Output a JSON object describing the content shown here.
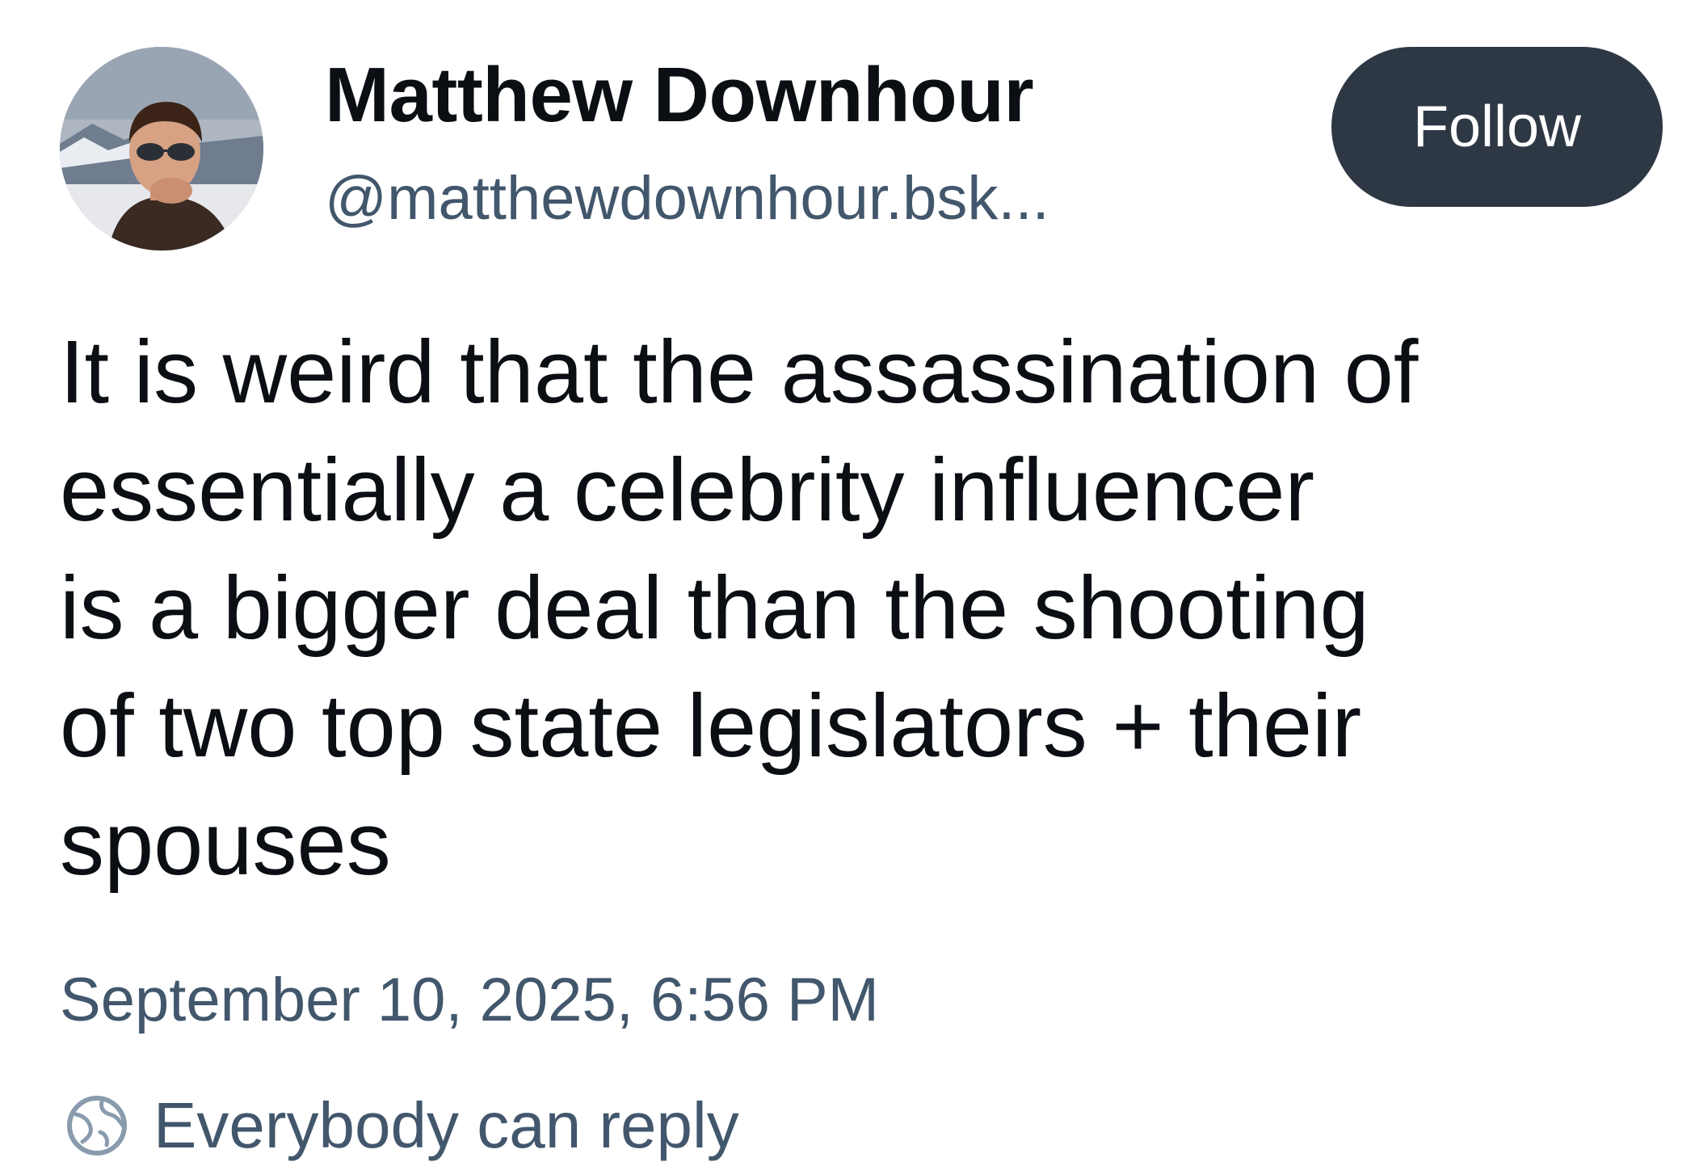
{
  "author": {
    "display_name": "Matthew Downhour",
    "handle": "@matthewdownhour.bsk..."
  },
  "follow_button": {
    "label": "Follow"
  },
  "post": {
    "lines": [
      "It is weird that the assassination of",
      "essentially a celebrity influencer",
      "is a bigger deal than the shooting",
      "of two top state legislators + their",
      "spouses"
    ],
    "timestamp": "September 10, 2025, 6:56 PM"
  },
  "reply_setting": {
    "label": "Everybody can reply",
    "icon": "globe-icon"
  },
  "colors": {
    "follow_bg": "#2e3845",
    "muted_text": "#42576c",
    "primary_text": "#0b0f14"
  }
}
